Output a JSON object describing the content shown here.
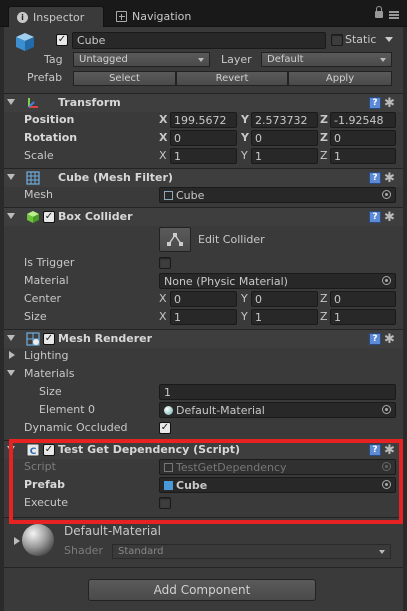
{
  "tabs": [
    {
      "label": "Inspector",
      "icon": "info-icon"
    },
    {
      "label": "Navigation",
      "icon": "navigation-icon"
    }
  ],
  "gameobject": {
    "name": "Cube",
    "static_label": "Static",
    "tag_label": "Tag",
    "tag_value": "Untagged",
    "layer_label": "Layer",
    "layer_value": "Default",
    "prefab_label": "Prefab",
    "select_label": "Select",
    "revert_label": "Revert",
    "apply_label": "Apply"
  },
  "transform": {
    "title": "Transform",
    "position_label": "Position",
    "rotation_label": "Rotation",
    "scale_label": "Scale",
    "position": {
      "x": "199.5672",
      "y": "2.573732",
      "z": "-1.92548"
    },
    "rotation": {
      "x": "0",
      "y": "0",
      "z": "0"
    },
    "scale": {
      "x": "1",
      "y": "1",
      "z": "1"
    }
  },
  "axis": {
    "x": "X",
    "y": "Y",
    "z": "Z"
  },
  "mesh_filter": {
    "title": "Cube (Mesh Filter)",
    "mesh_label": "Mesh",
    "mesh_value": "Cube"
  },
  "box_collider": {
    "title": "Box Collider",
    "edit_label": "Edit Collider",
    "is_trigger_label": "Is Trigger",
    "material_label": "Material",
    "material_value": "None (Physic Material)",
    "center_label": "Center",
    "center": {
      "x": "0",
      "y": "0",
      "z": "0"
    },
    "size_label": "Size",
    "size": {
      "x": "1",
      "y": "1",
      "z": "1"
    }
  },
  "mesh_renderer": {
    "title": "Mesh Renderer",
    "lighting_label": "Lighting",
    "materials_label": "Materials",
    "size_label": "Size",
    "size_value": "1",
    "element_label": "Element 0",
    "element_value": "Default-Material",
    "dynamic_occluded_label": "Dynamic Occluded"
  },
  "script_component": {
    "title": "Test Get Dependency (Script)",
    "script_label": "Script",
    "script_value": "TestGetDependency",
    "prefab_label": "Prefab",
    "prefab_value": "Cube",
    "execute_label": "Execute"
  },
  "material_preview": {
    "name": "Default-Material",
    "shader_label": "Shader",
    "shader_value": "Standard"
  },
  "add_component_label": "Add Component",
  "colors": {
    "highlight_box": "#e62222",
    "help_icon": "#5b8ad6"
  }
}
